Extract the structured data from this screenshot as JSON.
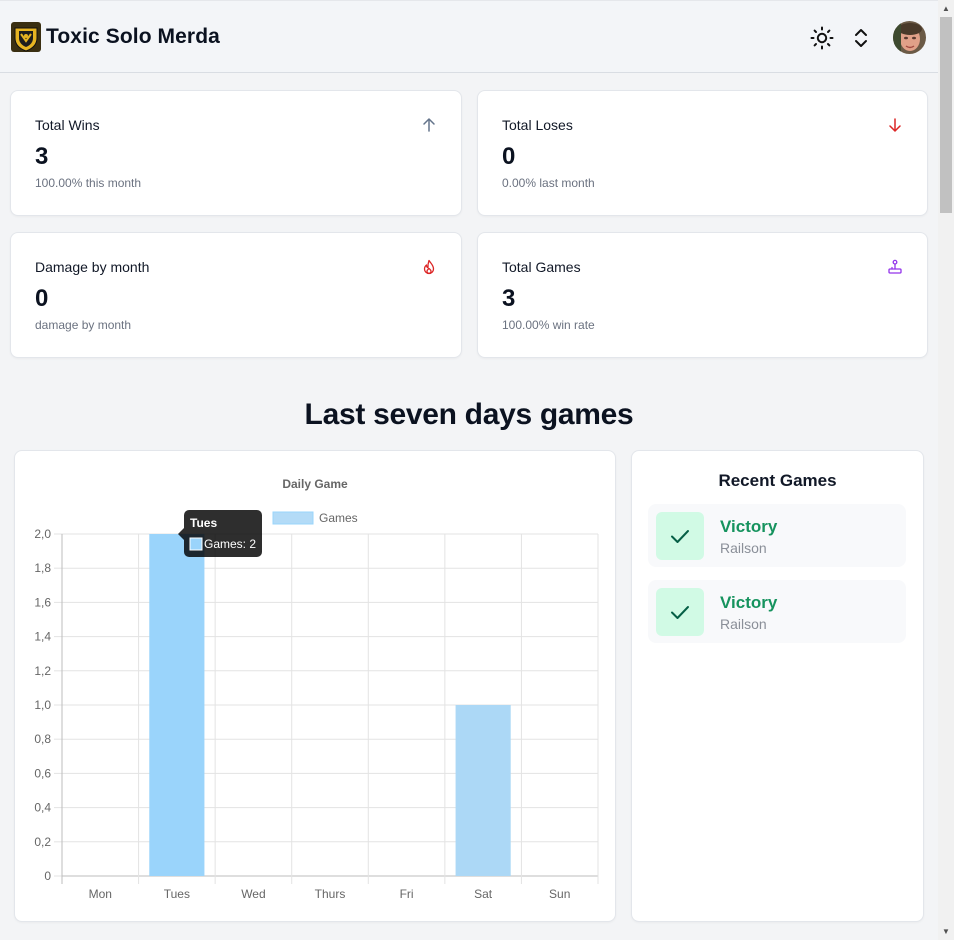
{
  "header": {
    "brand": "Toxic Solo Merda",
    "icons": [
      "shield-logo",
      "sun-icon",
      "chevron-up-down-icon",
      "avatar"
    ]
  },
  "stats": [
    {
      "title": "Total Wins",
      "value": "3",
      "sub": "100.00% this month",
      "icon": "arrow-up-icon",
      "icon_color": "#64748b"
    },
    {
      "title": "Total Loses",
      "value": "0",
      "sub": "0.00% last month",
      "icon": "arrow-down-icon",
      "icon_color": "#dc2626"
    },
    {
      "title": "Damage by month",
      "value": "0",
      "sub": "damage by month",
      "icon": "flame-icon",
      "icon_color": "#dc2626"
    },
    {
      "title": "Total Games",
      "value": "3",
      "sub": "100.00% win rate",
      "icon": "joystick-icon",
      "icon_color": "#9333ea"
    }
  ],
  "section_title": "Last seven days games",
  "chart_data": {
    "type": "bar",
    "title": "Daily Game",
    "categories": [
      "Mon",
      "Tues",
      "Wed",
      "Thurs",
      "Fri",
      "Sat",
      "Sun"
    ],
    "series": [
      {
        "name": "Games",
        "values": [
          0,
          2,
          0,
          0,
          0,
          1,
          0
        ]
      }
    ],
    "ylim": [
      0,
      2
    ],
    "yticks": [
      "0",
      "0,2",
      "0,4",
      "0,6",
      "0,8",
      "1,0",
      "1,2",
      "1,4",
      "1,6",
      "1,8",
      "2,0"
    ],
    "grid": true,
    "legend": "top",
    "bar_color": "#9ad4fb",
    "bar_color_muted": "#acd8f6",
    "tooltip": {
      "title": "Tues",
      "label": "Games: 2"
    }
  },
  "recent": {
    "title": "Recent Games",
    "items": [
      {
        "result": "Victory",
        "player": "Railson"
      },
      {
        "result": "Victory",
        "player": "Railson"
      }
    ]
  },
  "colors": {
    "victory": "#16935e",
    "check_bg": "#d1fae5"
  }
}
